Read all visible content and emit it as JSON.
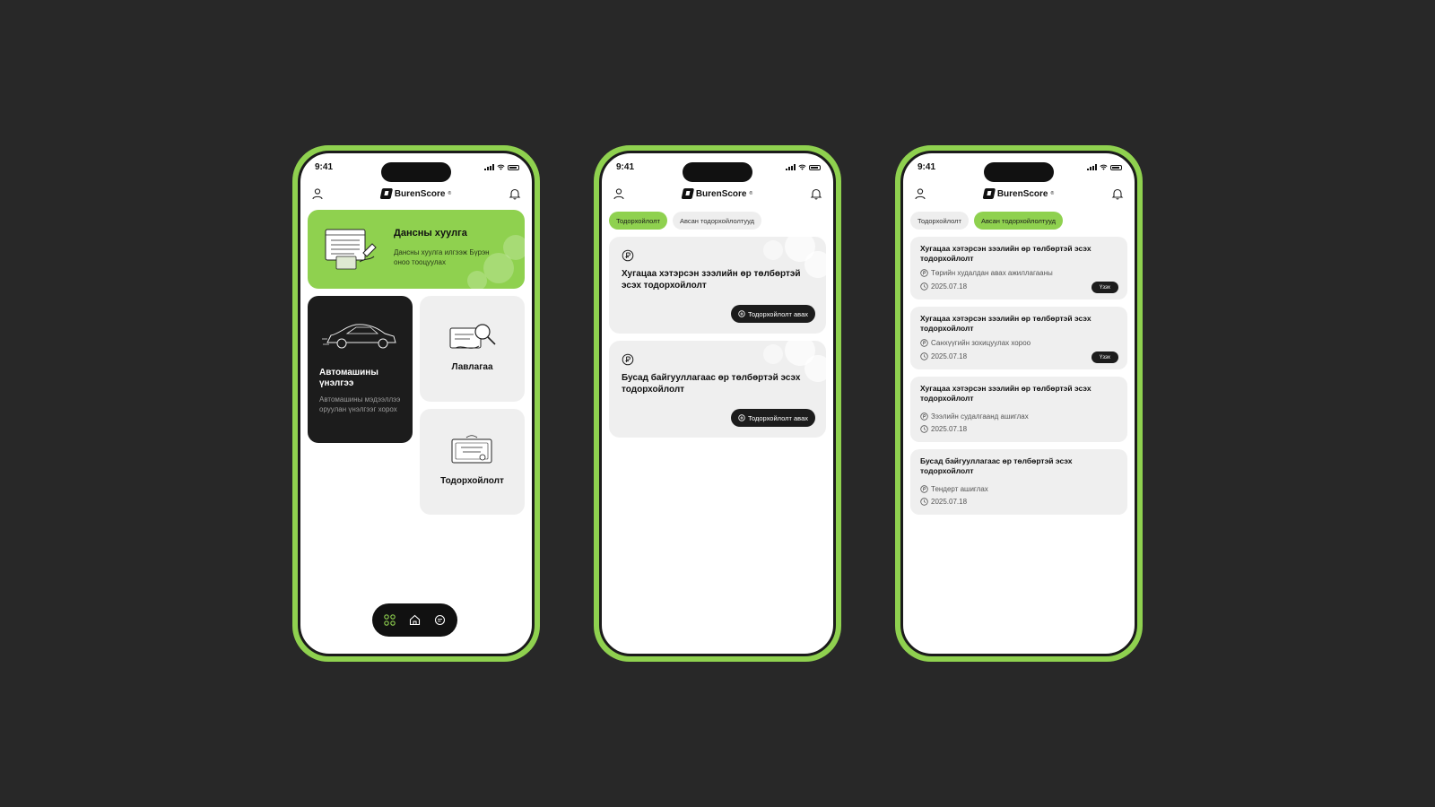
{
  "status_time": "9:41",
  "brand": {
    "name": "BurenScore",
    "reg": "®"
  },
  "colors": {
    "accent": "#8fd14f",
    "background": "#282828",
    "dark_card": "#1c1c1c",
    "light_card": "#efefef"
  },
  "home": {
    "hero": {
      "title": "Дансны хуулга",
      "desc": "Дансны хуулга илгээж Бүрэн оноо тооцуулах"
    },
    "car": {
      "title": "Автомашины үнэлгээ",
      "desc": "Автомашины мэдээллээ оруулан үнэлгээг хорох"
    },
    "reference": {
      "label": "Лавлагаа"
    },
    "certificate": {
      "label": "Тодорхойлолт"
    },
    "nav": {
      "apps_icon": "grid-icon",
      "home_icon": "home-icon",
      "chat_icon": "chat-icon"
    }
  },
  "requests": {
    "tabs": [
      "Тодорхойлолт",
      "Авсан тодорхойлолтууд"
    ],
    "cards": [
      {
        "title": "Хугацаа хэтэрсэн зээлийн өр төлбөртэй эсэх тодорхойлолт",
        "button": "Тодорхойлолт авах"
      },
      {
        "title": "Бусад байгууллагаас өр төлбөртэй эсэх тодорхойлолт",
        "button": "Тодорхойлолт авах"
      }
    ]
  },
  "history": {
    "tabs": [
      "Тодорхойлолт",
      "Авсан тодорхойлолтууд"
    ],
    "items": [
      {
        "title": "Хугацаа хэтэрсэн зээлийн өр төлбөртэй эсэх тодорхойлолт",
        "purpose": "Төрийн худалдан авах ажиллагааны",
        "date": "2025.07.18",
        "action": "Үзэх"
      },
      {
        "title": "Хугацаа хэтэрсэн зээлийн өр төлбөртэй эсэх тодорхойлолт",
        "purpose": "Санхүүгийн зохицуулах хороо",
        "date": "2025.07.18",
        "action": "Үзэх"
      },
      {
        "title": "Хугацаа хэтэрсэн зээлийн өр төлбөртэй эсэх тодорхойлолт",
        "purpose": "Зээлийн судалгаанд ашиглах",
        "date": "2025.07.18"
      },
      {
        "title": "Бусад байгууллагаас өр төлбөртэй эсэх тодорхойлолт",
        "purpose": "Тендерт ашиглах",
        "date": "2025.07.18"
      }
    ]
  }
}
